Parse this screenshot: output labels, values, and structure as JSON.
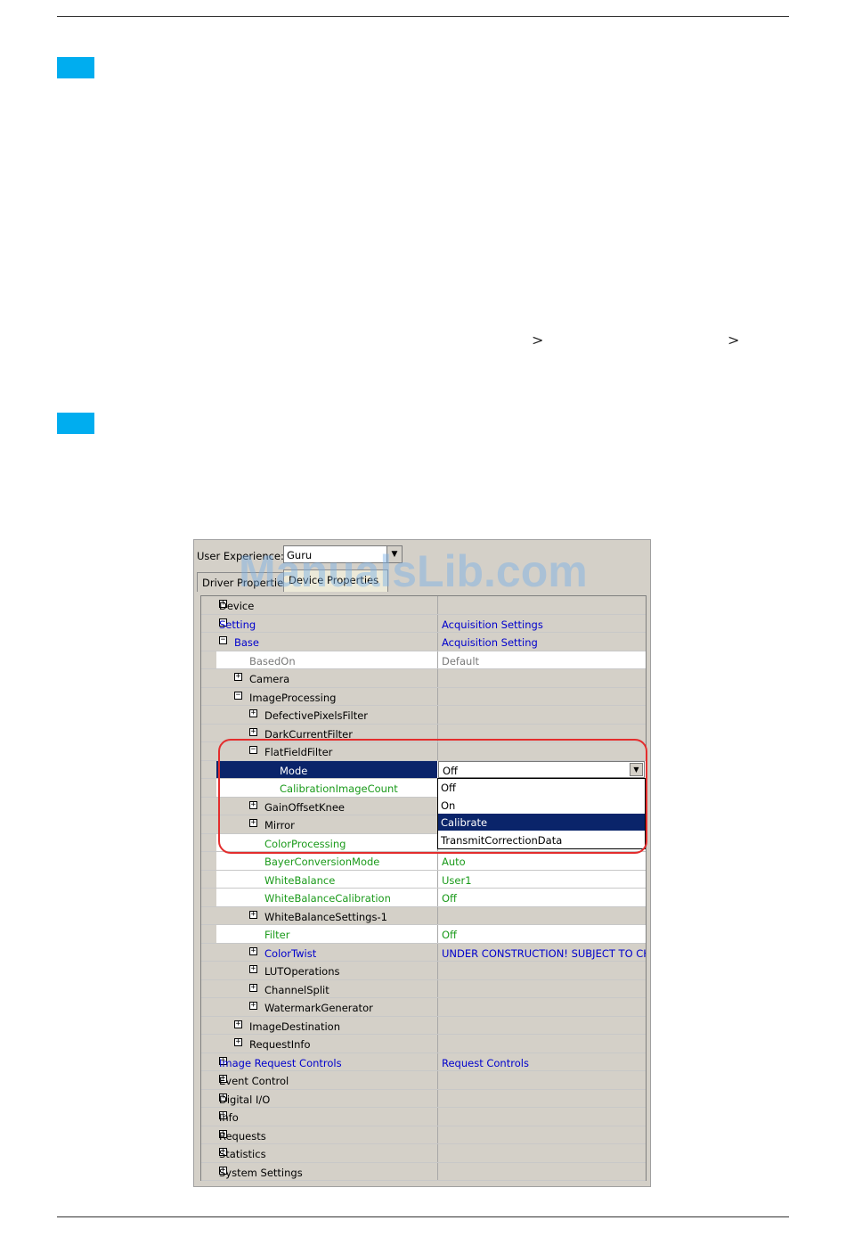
{
  "page": {
    "chevron_1": ">",
    "chevron_2": ">"
  },
  "app": {
    "user_experience_label": "User Experience:",
    "user_experience_value": "Guru",
    "tabs": [
      {
        "label": "Driver Properties"
      },
      {
        "label": "Device Properties"
      }
    ]
  },
  "watermark": "ManualsLib.com",
  "tree": [
    {
      "label": "Device",
      "value": ""
    },
    {
      "label": "Setting",
      "value": "Acquisition Settings"
    },
    {
      "label": "Base",
      "value": "Acquisition Setting"
    },
    {
      "label": "BasedOn",
      "value": "Default"
    },
    {
      "label": "Camera",
      "value": ""
    },
    {
      "label": "ImageProcessing",
      "value": ""
    },
    {
      "label": "DefectivePixelsFilter",
      "value": ""
    },
    {
      "label": "DarkCurrentFilter",
      "value": ""
    },
    {
      "label": "FlatFieldFilter",
      "value": ""
    },
    {
      "label": "Mode",
      "value": "Off"
    },
    {
      "label": "CalibrationImageCount",
      "value": ""
    },
    {
      "label": "GainOffsetKnee",
      "value": ""
    },
    {
      "label": "Mirror",
      "value": ""
    },
    {
      "label": "ColorProcessing",
      "value": ""
    },
    {
      "label": "BayerConversionMode",
      "value": "Auto"
    },
    {
      "label": "WhiteBalance",
      "value": "User1"
    },
    {
      "label": "WhiteBalanceCalibration",
      "value": "Off"
    },
    {
      "label": "WhiteBalanceSettings-1",
      "value": ""
    },
    {
      "label": "Filter",
      "value": "Off"
    },
    {
      "label": "ColorTwist",
      "value": "UNDER CONSTRUCTION! SUBJECT TO CH"
    },
    {
      "label": "LUTOperations",
      "value": ""
    },
    {
      "label": "ChannelSplit",
      "value": ""
    },
    {
      "label": "WatermarkGenerator",
      "value": ""
    },
    {
      "label": "ImageDestination",
      "value": ""
    },
    {
      "label": "RequestInfo",
      "value": ""
    },
    {
      "label": "Image Request Controls",
      "value": "Request Controls"
    },
    {
      "label": "Event Control",
      "value": ""
    },
    {
      "label": "Digital I/O",
      "value": ""
    },
    {
      "label": "Info",
      "value": ""
    },
    {
      "label": "Requests",
      "value": ""
    },
    {
      "label": "Statistics",
      "value": ""
    },
    {
      "label": "System Settings",
      "value": ""
    }
  ],
  "mode_dropdown": {
    "options": [
      "Off",
      "On",
      "Calibrate",
      "TransmitCorrectionData"
    ],
    "highlighted": "Calibrate"
  },
  "colors": {
    "accent_marker": "#00adef",
    "selection": "#0a246a",
    "highlight_ring": "#e32d2d",
    "feature_blue": "#0000cc",
    "feature_green": "#1a9a1a"
  }
}
